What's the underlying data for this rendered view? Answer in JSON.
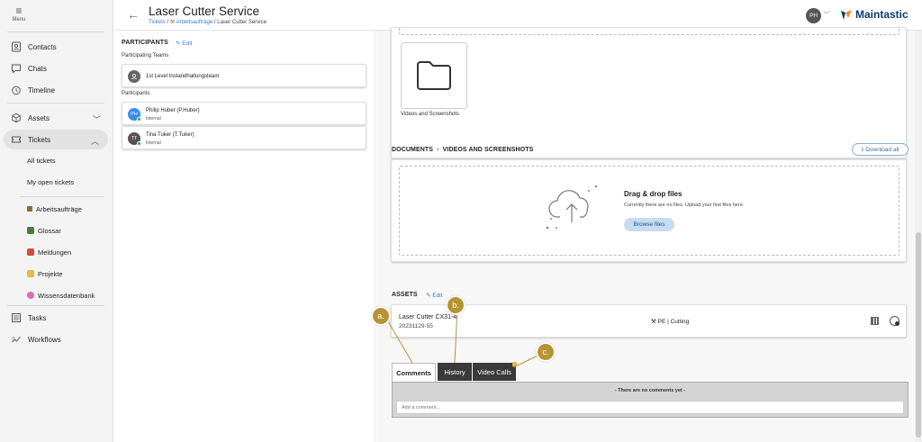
{
  "sidebar": {
    "menu_label": "Menu",
    "items": [
      {
        "label": "Contacts",
        "icon": "contacts-icon"
      },
      {
        "label": "Chats",
        "icon": "chat-icon"
      },
      {
        "label": "Timeline",
        "icon": "clock-icon"
      },
      {
        "label": "Assets",
        "icon": "cube-icon"
      },
      {
        "label": "Tickets",
        "icon": "ticket-icon"
      },
      {
        "label": "Tasks",
        "icon": "tasks-icon"
      },
      {
        "label": "Workflows",
        "icon": "workflow-icon"
      }
    ],
    "ticket_sub": [
      "All tickets",
      "My open tickets"
    ],
    "categories": [
      {
        "label": "Arbeitsaufträge",
        "color": "#8a6d3b"
      },
      {
        "label": "Glossar",
        "color": "#4a7a3a"
      },
      {
        "label": "Meldungen",
        "color": "#d64a3a"
      },
      {
        "label": "Projekte",
        "color": "#e8b840"
      },
      {
        "label": "Wissensdatenbank",
        "color": "#d870b0"
      }
    ]
  },
  "header": {
    "title": "Laser Cutter Service",
    "breadcrumb": [
      "Tickets",
      "Arbeitsaufträge",
      "Laser Cutter Service"
    ],
    "sep": "/",
    "user_initials": "PH",
    "logo_text": "Maintastic"
  },
  "participants": {
    "heading": "PARTICIPANTS",
    "edit_label": "Edit",
    "teams_label": "Participating Teams",
    "team": "1st Level Instandhaltungsteam",
    "people_label": "Participants",
    "people": [
      {
        "initials": "PH",
        "name": "Philip Huber (P.Huber)",
        "role": "Internal",
        "color": "#3a8ee6"
      },
      {
        "initials": "TT",
        "name": "Tina Tuker (T.Tuker)",
        "role": "Internal",
        "color": "#555555"
      }
    ]
  },
  "documents": {
    "folder_label": "Videos and Screenshots",
    "breadcrumb_root": "DOCUMENTS",
    "breadcrumb_sub": "VIDEOS AND SCREENSHOTS",
    "download_all": "Download all",
    "drop_title": "Drag & drop files",
    "drop_sub": "Currently there are no files. Upload your first files here.",
    "browse": "Browse files"
  },
  "assets": {
    "heading": "ASSETS",
    "edit_label": "Edit",
    "name": "Laser Cutter CX31-4",
    "id": "20231129-55",
    "location": "PE | Cutting"
  },
  "tabs": [
    "Comments",
    "History",
    "Video Calls"
  ],
  "comments": {
    "empty": "- There are no comments yet -",
    "placeholder": "Add a comment..."
  },
  "markers": [
    "a.",
    "b.",
    "c."
  ]
}
